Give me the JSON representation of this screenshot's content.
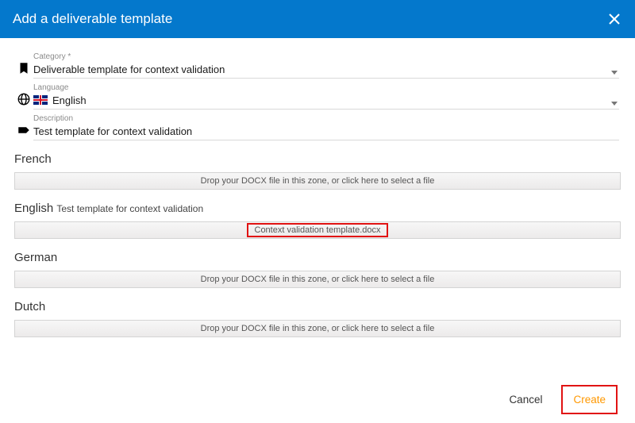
{
  "header": {
    "title": "Add a deliverable template"
  },
  "fields": {
    "category": {
      "label": "Category *",
      "value": "Deliverable template for context validation"
    },
    "language": {
      "label": "Language",
      "value": "English"
    },
    "description": {
      "label": "Description",
      "value": "Test template for context validation"
    }
  },
  "dropzonePlaceholder": "Drop your DOCX file in this zone, or click here to select a file",
  "sections": {
    "french": {
      "title": "French"
    },
    "english": {
      "title": "English",
      "subtitle": "Test template for context validation",
      "filename": "Context validation template.docx"
    },
    "german": {
      "title": "German"
    },
    "dutch": {
      "title": "Dutch"
    }
  },
  "footer": {
    "cancel": "Cancel",
    "create": "Create"
  }
}
